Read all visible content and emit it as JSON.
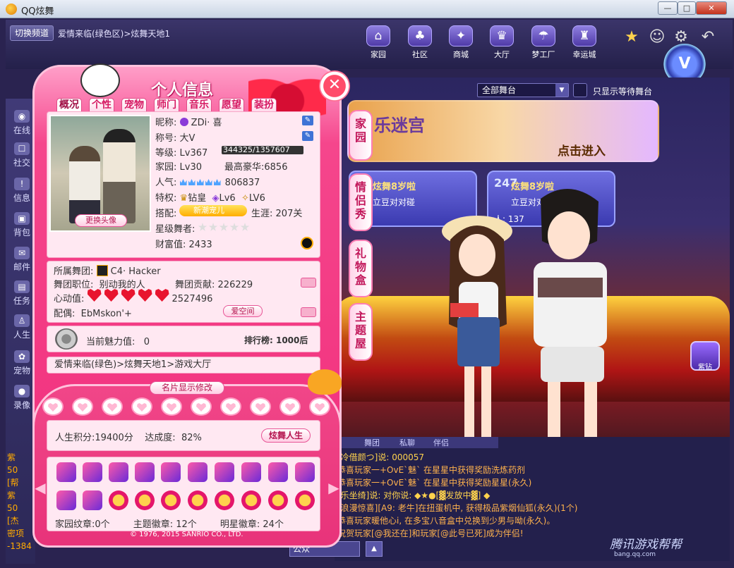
{
  "window": {
    "title": "QQ炫舞",
    "min_label": "—",
    "max_label": "□",
    "close_label": "✕"
  },
  "topbar": {
    "channel_button": "切换频道",
    "breadcrumb": "爱情来临(绿色区)>炫舞天地1",
    "nav": [
      {
        "label": "家园",
        "icon": "house-icon"
      },
      {
        "label": "社区",
        "icon": "palm-tree-icon"
      },
      {
        "label": "商城",
        "icon": "shop-icon"
      },
      {
        "label": "大厅",
        "icon": "hall-icon"
      },
      {
        "label": "梦工厂",
        "icon": "rainbow-icon"
      },
      {
        "label": "幸运城",
        "icon": "lucky-city-icon"
      }
    ],
    "vip_label": "V"
  },
  "sidebar": {
    "items": [
      {
        "label": "在线",
        "icon": "eye-icon"
      },
      {
        "label": "社交",
        "icon": "chat-icon"
      },
      {
        "label": "信息",
        "icon": "info-icon"
      },
      {
        "label": "背包",
        "icon": "bag-icon"
      },
      {
        "label": "邮件",
        "icon": "mail-icon"
      },
      {
        "label": "任务",
        "icon": "task-icon"
      },
      {
        "label": "人生",
        "icon": "person-icon"
      },
      {
        "label": "宠物",
        "icon": "paw-icon"
      },
      {
        "label": "录像",
        "icon": "record-icon"
      }
    ]
  },
  "lobby": {
    "stage_select": "全部舞台",
    "wait_only_label": "只显示等待舞台",
    "banner_title": "乐迷宫",
    "banner_button": "点击进入",
    "rooms": [
      {
        "number": "",
        "name": "炫舞8岁啦",
        "mode": "立豆对对碰",
        "people": ""
      },
      {
        "number": "247",
        "name": "炫舞8岁啦",
        "mode": "立豆对对碰",
        "people": "人: 137"
      }
    ],
    "side_tabs": [
      "家园",
      "情侣秀",
      "礼物盒",
      "主题屋"
    ],
    "diamond_label": "紫钻"
  },
  "chat": {
    "tabs": [
      "舞团",
      "私聊",
      "伴侣"
    ],
    "lines": [
      "[冷借颜つ]说: 000057",
      "恭喜玩家一+OvE`魅` 在星星中获得奖励洗炼药剂",
      "恭喜玩家一+OvE`魅` 在星星中获得奖励星星(永久)",
      "[乐坐绮]说: 对你说: ◆★●[▓发放中▓] ◆",
      "[浪漫惊喜][A9: 老牛]在扭蛋机中, 获得极品紫烟仙狐(永久)(1个)",
      "恭喜玩家暖他心i, 在多宝八音盒中兑换到少男与呦(永久)。",
      "祝贺玩家[@我还在]和玩家[@此号已死]成为伴侣!"
    ],
    "input_value": "公众",
    "left_numbers": [
      "紫",
      "50",
      "[帮",
      "紫",
      "50",
      "[杰",
      "密项",
      "-1384"
    ]
  },
  "watermark": {
    "text": "腾讯游戏帮帮",
    "url": "bang.qq.com"
  },
  "profile": {
    "title": "个人信息",
    "close_label": "✕",
    "tabs": [
      "概况",
      "个性",
      "宠物",
      "师门",
      "音乐",
      "愿望",
      "装扮"
    ],
    "change_avatar": "更换头像",
    "fields": {
      "nickname_label": "昵称:",
      "nickname": "ZDi· 喜",
      "title_label": "称号:",
      "title": "大V",
      "level_label": "等级:",
      "level": "Lv367",
      "exp": "344325/1357607",
      "home_label": "家园:",
      "home": "Lv30",
      "luxury_label": "最高豪华:",
      "luxury": "6856",
      "popularity_label": "人气:",
      "popularity": "806837",
      "privilege_label": "特权:",
      "privilege_1": "钻皇",
      "privilege_2": "Lv6",
      "privilege_3": "LV6",
      "match_label": "搭配:",
      "pet_badge": "新潮宠儿",
      "career_label": "生涯:",
      "career": "207关",
      "star_dancer_label": "星级舞者:",
      "stars": 0,
      "wealth_label": "财富值:",
      "wealth": "2433"
    },
    "team": {
      "team_label": "所属舞团:",
      "team_name": "C4· Hacker",
      "position_label": "舞团职位:",
      "position": "别动我的人",
      "contribution_label": "舞团贡献:",
      "contribution": "226229",
      "heart_label": "心动值:",
      "heart_value": "2527496",
      "partner_label": "配偶:",
      "partner": "EbMskon'+",
      "love_space": "爱空间"
    },
    "charm": {
      "label": "当前魅力值:",
      "value": "0",
      "rank": "排行榜: 1000后"
    },
    "location": "爱情来临(绿色)>炫舞天地1>游戏大厅",
    "card_edit": "名片显示修改",
    "life": {
      "score_label": "人生积分:",
      "score": "19400分",
      "achieve_label": "达成度:",
      "achieve": "82%",
      "button": "炫舞人生"
    },
    "badges": {
      "home_label": "家园纹章:",
      "home_count": "0个",
      "theme_label": "主题徽章:",
      "theme_count": "12个",
      "star_label": "明星徽章:",
      "star_count": "24个"
    },
    "copyright": "© 1976, 2015 SANRIO CO., LTD."
  },
  "colors": {
    "accent_pink": "#f2337f",
    "frame": "#2a2350",
    "gold": "#ffe27a"
  }
}
